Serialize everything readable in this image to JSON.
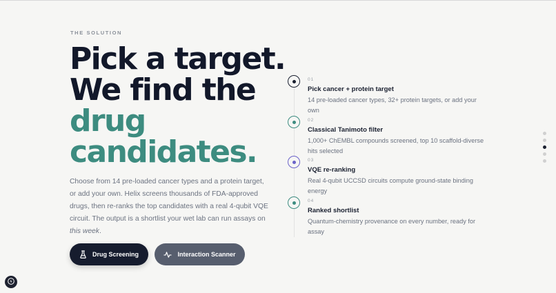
{
  "eyebrow": "THE SOLUTION",
  "headline": {
    "line1": "Pick a target.",
    "line2": "We find the",
    "line3": "drug",
    "line4": "candidates."
  },
  "description": {
    "text": "Choose from 14 pre-loaded cancer types and a protein target, or add your own. Helix screens thousands of FDA-approved drugs, then re-ranks the top candidates with a real 4-qubit VQE circuit. The output is a shortlist your wet lab can run assays on ",
    "emphasis": "this week",
    "end": "."
  },
  "buttons": {
    "primary": {
      "label": "Drug Screening",
      "icon": "flask-icon"
    },
    "secondary": {
      "label": "Interaction Scanner",
      "icon": "activity-icon"
    }
  },
  "steps": [
    {
      "num": "01",
      "title": "Pick cancer + protein target",
      "desc": "14 pre-loaded cancer types, 32+ protein targets, or add your own",
      "color": "#1a2030"
    },
    {
      "num": "02",
      "title": "Classical Tanimoto filter",
      "desc": "1,000+ ChEMBL compounds screened, top 10 scaffold-diverse hits selected",
      "color": "#3d8c80"
    },
    {
      "num": "03",
      "title": "VQE re-ranking",
      "desc": "Real 4-qubit UCCSD circuits compute ground-state binding energy",
      "color": "#6b63c9"
    },
    {
      "num": "04",
      "title": "Ranked shortlist",
      "desc": "Quantum-chemistry provenance on every number, ready for assay",
      "color": "#3d8c80"
    }
  ],
  "side_nav": {
    "count": 5,
    "active_index": 2
  },
  "colors": {
    "accent": "#3d8c80",
    "dark": "#161c2e",
    "secondary_button": "#575e6e"
  }
}
